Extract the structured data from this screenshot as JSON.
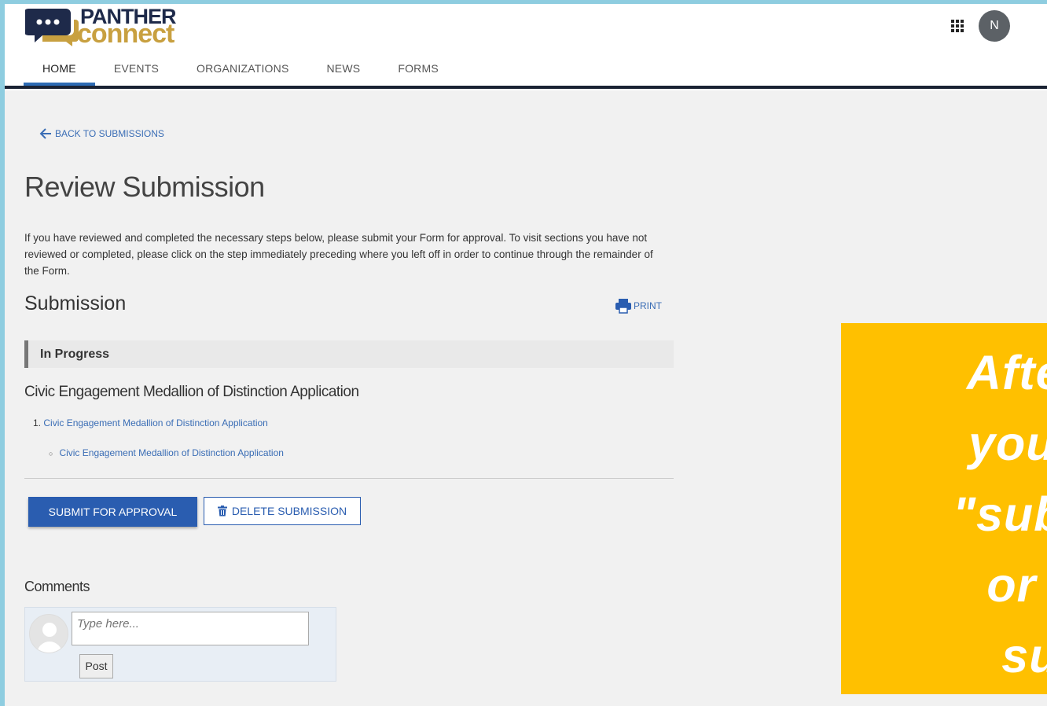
{
  "header": {
    "logo_top": "PANTHER",
    "logo_bottom": "connect",
    "avatar_initial": "N"
  },
  "nav": {
    "items": [
      "HOME",
      "EVENTS",
      "ORGANIZATIONS",
      "NEWS",
      "FORMS"
    ],
    "active": "HOME"
  },
  "back_link": "BACK TO SUBMISSIONS",
  "page_title": "Review Submission",
  "intro": "If you have reviewed and completed the necessary steps below, please submit your Form for approval. To visit sections you have not reviewed or completed, please click on the step immediately preceding where you left off in order to continue through the remainder of the Form.",
  "submission": {
    "title": "Submission",
    "print_label": "PRINT",
    "status": "In Progress",
    "form_name": "Civic Engagement Medallion of Distinction Application",
    "step_number": "1.",
    "step_label": "Civic Engagement Medallion of Distinction Application",
    "substep_label": "Civic Engagement Medallion of Distinction Application"
  },
  "actions": {
    "submit_label": "SUBMIT FOR APPROVAL",
    "delete_label": "DELETE SUBMISSION"
  },
  "comments": {
    "label": "Comments",
    "placeholder": "Type here...",
    "post_label": "Post"
  },
  "callout": {
    "lines": [
      "After c",
      "you wi",
      "\"submit",
      "or \"d",
      "sub"
    ]
  },
  "colors": {
    "accent": "#2a5db0",
    "link": "#3a6db5",
    "callout_bg": "#ffc000",
    "page_bg": "#f1f1f1"
  }
}
